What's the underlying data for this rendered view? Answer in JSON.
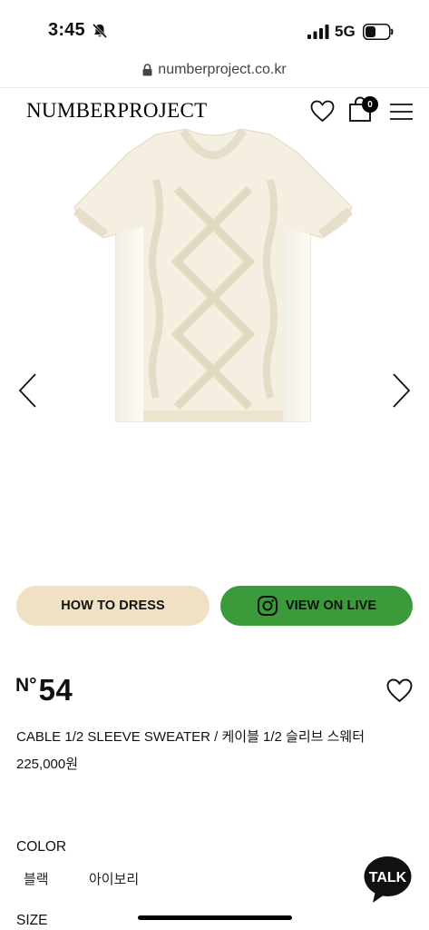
{
  "status_bar": {
    "time": "3:45",
    "network": "5G"
  },
  "browser": {
    "url": "numberproject.co.kr"
  },
  "header": {
    "logo": "NUMBERPROJECT",
    "cart_count": "0"
  },
  "actions": {
    "how_to_dress": "HOW TO DRESS",
    "view_on_live": "VIEW ON LIVE"
  },
  "product": {
    "number_prefix": "N°",
    "number": "54",
    "name": "CABLE 1/2 SLEEVE SWEATER / 케이블 1/2 슬리브 스웨터",
    "price": "225,000원"
  },
  "options": {
    "color_label": "COLOR",
    "colors": [
      "블랙",
      "아이보리"
    ],
    "size_label": "SIZE"
  },
  "chat": {
    "label": "TALK"
  },
  "colors": {
    "how_to_dress_bg": "#f0e1c4",
    "view_on_live_bg": "#3b9a3a",
    "sweater": "#f4efe1"
  }
}
